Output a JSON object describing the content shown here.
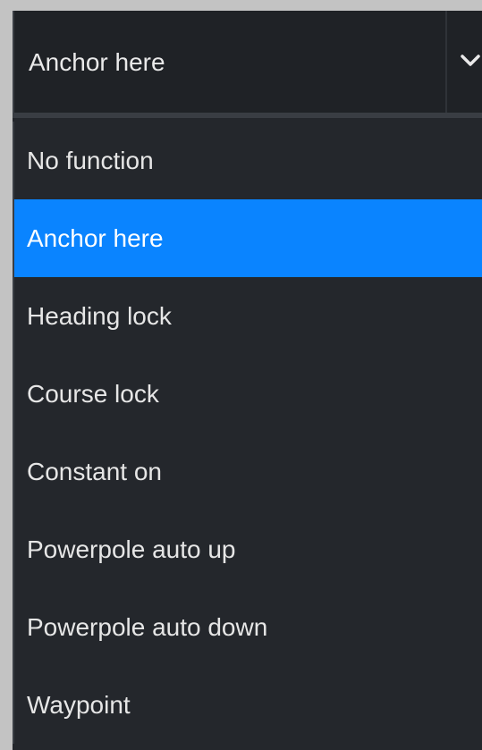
{
  "select": {
    "value": "Anchor here",
    "chevron_icon": "chevron-down-icon"
  },
  "colors": {
    "selected_bg": "#0a84ff",
    "panel_bg": "#24272c",
    "text": "#e6e6e6"
  },
  "options": [
    {
      "label": "No function",
      "selected": false
    },
    {
      "label": "Anchor here",
      "selected": true
    },
    {
      "label": "Heading lock",
      "selected": false
    },
    {
      "label": "Course lock",
      "selected": false
    },
    {
      "label": "Constant on",
      "selected": false
    },
    {
      "label": "Powerpole auto up",
      "selected": false
    },
    {
      "label": "Powerpole auto down",
      "selected": false
    },
    {
      "label": "Waypoint",
      "selected": false
    }
  ]
}
